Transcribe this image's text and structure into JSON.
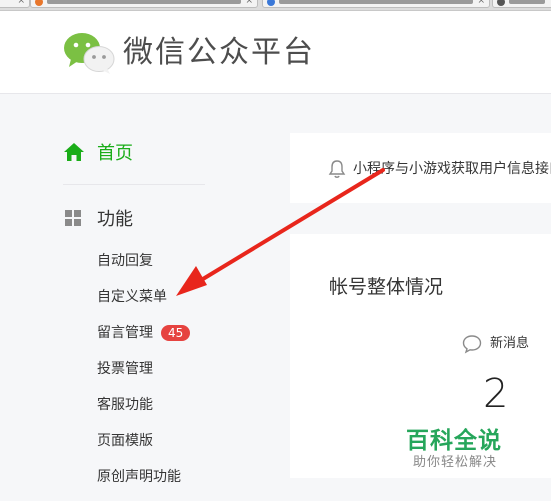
{
  "header": {
    "logo_text": "微信公众平台",
    "logo_icon": "wechat-logo"
  },
  "sidebar": {
    "home": {
      "label": "首页",
      "icon": "home-icon",
      "color": "#1aad19"
    },
    "function": {
      "label": "功能",
      "icon": "grid-icon"
    },
    "items": [
      {
        "label": "自动回复"
      },
      {
        "label": "自定义菜单"
      },
      {
        "label": "留言管理",
        "badge": "45",
        "badge_color": "#e64340"
      },
      {
        "label": "投票管理"
      },
      {
        "label": "客服功能"
      },
      {
        "label": "页面模版"
      },
      {
        "label": "原创声明功能"
      }
    ]
  },
  "notice": {
    "icon": "bell-icon",
    "text": "小程序与小游戏获取用户信息接口"
  },
  "overview": {
    "title": "帐号整体情况",
    "new_messages_label": "新消息",
    "new_messages_value": "2",
    "icon": "speech-bubble-icon"
  },
  "watermark": {
    "title": "百科全说",
    "subtitle": "助你轻松解决"
  },
  "annotation": {
    "color": "#e8261c"
  }
}
